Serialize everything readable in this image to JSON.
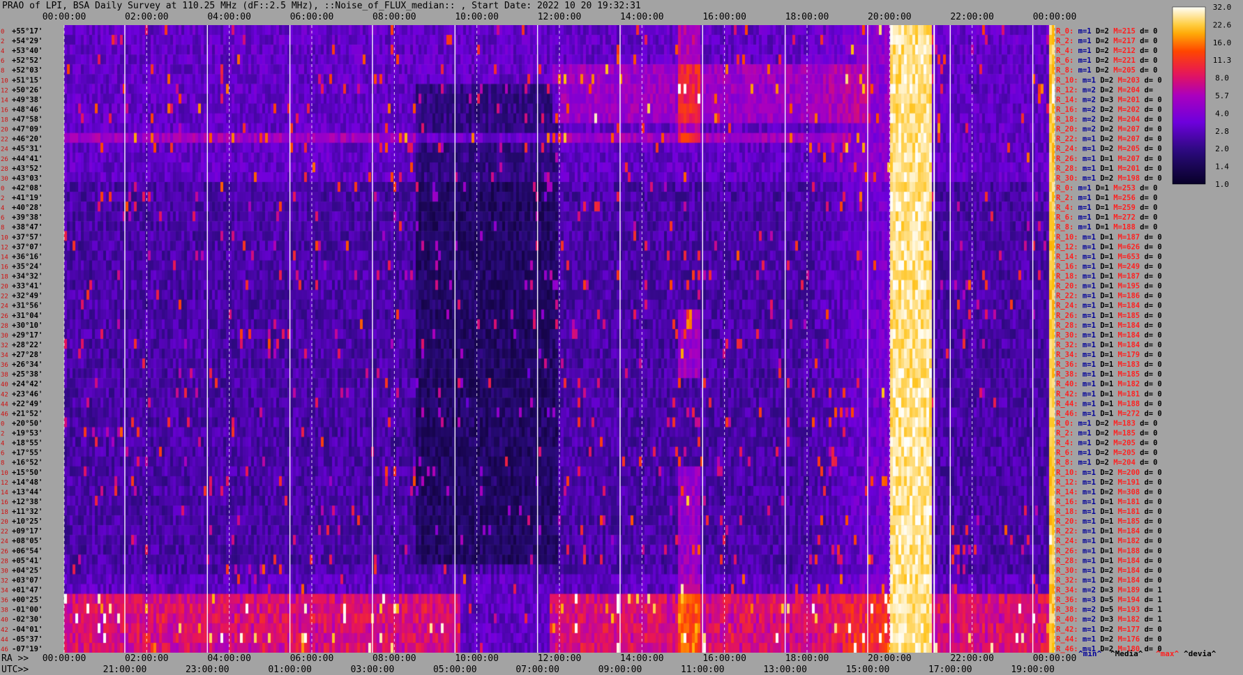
{
  "title": "PRAO of LPI, BSA Daily Survey at 110.25 MHz (dF::2.5 MHz), ::Noise_of_FLUX_median:: , Start Date: 2022 10 20 19:32:31",
  "chart_data": {
    "type": "heatmap",
    "x_top_ticks": [
      "00:00:00",
      "02:00:00",
      "04:00:00",
      "06:00:00",
      "08:00:00",
      "10:00:00",
      "12:00:00",
      "14:00:00",
      "16:00:00",
      "18:00:00",
      "20:00:00",
      "22:00:00",
      "00:00:00"
    ],
    "x_bottom_ra_ticks": [
      "00:00:00",
      "02:00:00",
      "04:00:00",
      "06:00:00",
      "08:00:00",
      "10:00:00",
      "12:00:00",
      "14:00:00",
      "16:00:00",
      "18:00:00",
      "20:00:00",
      "22:00:00",
      "00:00:00"
    ],
    "x_bottom_utc_ticks": [
      "21:00:00",
      "23:00:00",
      "01:00:00",
      "03:00:00",
      "05:00:00",
      "07:00:00",
      "09:00:00",
      "11:00:00",
      "13:00:00",
      "15:00:00",
      "17:00:00",
      "19:00:00"
    ],
    "ra_label": "RA >>",
    "utc_label": "UTC>>",
    "colorbar_ticks": [
      "32.0",
      "22.6",
      "16.0",
      "11.3",
      "8.0",
      "5.7",
      "4.0",
      "2.8",
      "2.0",
      "1.4",
      "1.0"
    ],
    "legend_labels": [
      "^min^",
      "^Media^",
      "^max^",
      "^devia^"
    ],
    "declinations": [
      "+55°17'",
      "+54°29'",
      "+53°40'",
      "+52°52'",
      "+52°03'",
      "+51°15'",
      "+50°26'",
      "+49°38'",
      "+48°46'",
      "+47°58'",
      "+47°09'",
      "+46°20'",
      "+45°31'",
      "+44°41'",
      "+43°52'",
      "+43°03'",
      "+42°08'",
      "+41°19'",
      "+40°28'",
      "+39°38'",
      "+38°47'",
      "+37°57'",
      "+37°07'",
      "+36°16'",
      "+35°24'",
      "+34°32'",
      "+33°41'",
      "+32°49'",
      "+31°56'",
      "+31°04'",
      "+30°10'",
      "+29°17'",
      "+28°22'",
      "+27°28'",
      "+26°34'",
      "+25°38'",
      "+24°42'",
      "+23°46'",
      "+22°49'",
      "+21°52'",
      "+20°50'",
      "+19°53'",
      "+18°55'",
      "+17°55'",
      "+16°52'",
      "+15°50'",
      "+14°48'",
      "+13°44'",
      "+12°38'",
      "+11°32'",
      "+10°25'",
      "+09°17'",
      "+08°05'",
      "+06°54'",
      "+05°41'",
      "+04°25'",
      "+03°07'",
      "+01°47'",
      "+00°25'",
      "-01°00'",
      "-02°30'",
      "-04°01'",
      "-05°37'",
      "-07°19'"
    ],
    "row_indices": [
      "0",
      "2",
      "4",
      "6",
      "8",
      "10",
      "12",
      "14",
      "16",
      "18",
      "20",
      "22",
      "24",
      "26",
      "28",
      "30",
      "0",
      "2",
      "4",
      "6",
      "8",
      "10",
      "12",
      "14",
      "16",
      "18",
      "20",
      "22",
      "24",
      "26",
      "28",
      "30",
      "32",
      "34",
      "36",
      "38",
      "40",
      "42",
      "44",
      "46",
      "0",
      "2",
      "4",
      "6",
      "8",
      "10",
      "12",
      "14",
      "16",
      "18",
      "20",
      "22",
      "24",
      "26",
      "28",
      "30",
      "32",
      "34",
      "36",
      "38",
      "40",
      "42",
      "44",
      "46"
    ],
    "stats": [
      {
        "r": "R_0:",
        "m": "m=1",
        "d": "D=2",
        "M": "M=215",
        "dv": "d= 0"
      },
      {
        "r": "R_2:",
        "m": "m=1",
        "d": "D=2",
        "M": "M=217",
        "dv": "d= 0"
      },
      {
        "r": "R_4:",
        "m": "m=1",
        "d": "D=2",
        "M": "M=212",
        "dv": "d= 0"
      },
      {
        "r": "R_6:",
        "m": "m=1",
        "d": "D=2",
        "M": "M=221",
        "dv": "d= 0"
      },
      {
        "r": "R_8:",
        "m": "m=1",
        "d": "D=2",
        "M": "M=205",
        "dv": "d= 0"
      },
      {
        "r": "R_10:",
        "m": "m=1",
        "d": "D=2",
        "M": "M=203",
        "dv": "d= 0"
      },
      {
        "r": "R_12:",
        "m": "m=2",
        "d": "D=2",
        "M": "M=204",
        "dv": "d= "
      },
      {
        "r": "R_14:",
        "m": "m=2",
        "d": "D=3",
        "M": "M=201",
        "dv": "d= 0"
      },
      {
        "r": "R_16:",
        "m": "m=2",
        "d": "D=2",
        "M": "M=202",
        "dv": "d= 0"
      },
      {
        "r": "R_18:",
        "m": "m=2",
        "d": "D=2",
        "M": "M=204",
        "dv": "d= 0"
      },
      {
        "r": "R_20:",
        "m": "m=2",
        "d": "D=2",
        "M": "M=207",
        "dv": "d= 0"
      },
      {
        "r": "R_22:",
        "m": "m=1",
        "d": "D=2",
        "M": "M=207",
        "dv": "d= 0"
      },
      {
        "r": "R_24:",
        "m": "m=1",
        "d": "D=2",
        "M": "M=205",
        "dv": "d= 0"
      },
      {
        "r": "R_26:",
        "m": "m=1",
        "d": "D=1",
        "M": "M=207",
        "dv": "d= 0"
      },
      {
        "r": "R_28:",
        "m": "m=1",
        "d": "D=1",
        "M": "M=201",
        "dv": "d= 0"
      },
      {
        "r": "R_30:",
        "m": "m=1",
        "d": "D=2",
        "M": "M=198",
        "dv": "d= 0"
      },
      {
        "r": "R_0:",
        "m": "m=1",
        "d": "D=1",
        "M": "M=253",
        "dv": "d= 0"
      },
      {
        "r": "R_2:",
        "m": "m=1",
        "d": "D=1",
        "M": "M=256",
        "dv": "d= 0"
      },
      {
        "r": "R_4:",
        "m": "m=1",
        "d": "D=1",
        "M": "M=259",
        "dv": "d= 0"
      },
      {
        "r": "R_6:",
        "m": "m=1",
        "d": "D=1",
        "M": "M=272",
        "dv": "d= 0"
      },
      {
        "r": "R_8:",
        "m": "m=1",
        "d": "D=1",
        "M": "M=188",
        "dv": "d= 0"
      },
      {
        "r": "R_10:",
        "m": "m=1",
        "d": "D=1",
        "M": "M=187",
        "dv": "d= 0"
      },
      {
        "r": "R_12:",
        "m": "m=1",
        "d": "D=1",
        "M": "M=626",
        "dv": "d= 0"
      },
      {
        "r": "R_14:",
        "m": "m=1",
        "d": "D=1",
        "M": "M=653",
        "dv": "d= 0"
      },
      {
        "r": "R_16:",
        "m": "m=1",
        "d": "D=1",
        "M": "M=249",
        "dv": "d= 0"
      },
      {
        "r": "R_18:",
        "m": "m=1",
        "d": "D=1",
        "M": "M=187",
        "dv": "d= 0"
      },
      {
        "r": "R_20:",
        "m": "m=1",
        "d": "D=1",
        "M": "M=195",
        "dv": "d= 0"
      },
      {
        "r": "R_22:",
        "m": "m=1",
        "d": "D=1",
        "M": "M=186",
        "dv": "d= 0"
      },
      {
        "r": "R_24:",
        "m": "m=1",
        "d": "D=1",
        "M": "M=184",
        "dv": "d= 0"
      },
      {
        "r": "R_26:",
        "m": "m=1",
        "d": "D=1",
        "M": "M=185",
        "dv": "d= 0"
      },
      {
        "r": "R_28:",
        "m": "m=1",
        "d": "D=1",
        "M": "M=184",
        "dv": "d= 0"
      },
      {
        "r": "R_30:",
        "m": "m=1",
        "d": "D=1",
        "M": "M=184",
        "dv": "d= 0"
      },
      {
        "r": "R_32:",
        "m": "m=1",
        "d": "D=1",
        "M": "M=184",
        "dv": "d= 0"
      },
      {
        "r": "R_34:",
        "m": "m=1",
        "d": "D=1",
        "M": "M=179",
        "dv": "d= 0"
      },
      {
        "r": "R_36:",
        "m": "m=1",
        "d": "D=1",
        "M": "M=183",
        "dv": "d= 0"
      },
      {
        "r": "R_38:",
        "m": "m=1",
        "d": "D=1",
        "M": "M=185",
        "dv": "d= 0"
      },
      {
        "r": "R_40:",
        "m": "m=1",
        "d": "D=1",
        "M": "M=182",
        "dv": "d= 0"
      },
      {
        "r": "R_42:",
        "m": "m=1",
        "d": "D=1",
        "M": "M=181",
        "dv": "d= 0"
      },
      {
        "r": "R_44:",
        "m": "m=1",
        "d": "D=1",
        "M": "M=188",
        "dv": "d= 0"
      },
      {
        "r": "R_46:",
        "m": "m=1",
        "d": "D=1",
        "M": "M=272",
        "dv": "d= 0"
      },
      {
        "r": "R_0:",
        "m": "m=1",
        "d": "D=2",
        "M": "M=183",
        "dv": "d= 0"
      },
      {
        "r": "R_2:",
        "m": "m=1",
        "d": "D=2",
        "M": "M=185",
        "dv": "d= 0"
      },
      {
        "r": "R_4:",
        "m": "m=1",
        "d": "D=2",
        "M": "M=205",
        "dv": "d= 0"
      },
      {
        "r": "R_6:",
        "m": "m=1",
        "d": "D=2",
        "M": "M=205",
        "dv": "d= 0"
      },
      {
        "r": "R_8:",
        "m": "m=1",
        "d": "D=2",
        "M": "M=204",
        "dv": "d= 0"
      },
      {
        "r": "R_10:",
        "m": "m=1",
        "d": "D=2",
        "M": "M=200",
        "dv": "d= 0"
      },
      {
        "r": "R_12:",
        "m": "m=1",
        "d": "D=2",
        "M": "M=191",
        "dv": "d= 0"
      },
      {
        "r": "R_14:",
        "m": "m=1",
        "d": "D=2",
        "M": "M=308",
        "dv": "d= 0"
      },
      {
        "r": "R_16:",
        "m": "m=1",
        "d": "D=1",
        "M": "M=181",
        "dv": "d= 0"
      },
      {
        "r": "R_18:",
        "m": "m=1",
        "d": "D=1",
        "M": "M=181",
        "dv": "d= 0"
      },
      {
        "r": "R_20:",
        "m": "m=1",
        "d": "D=1",
        "M": "M=185",
        "dv": "d= 0"
      },
      {
        "r": "R_22:",
        "m": "m=1",
        "d": "D=1",
        "M": "M=184",
        "dv": "d= 0"
      },
      {
        "r": "R_24:",
        "m": "m=1",
        "d": "D=1",
        "M": "M=182",
        "dv": "d= 0"
      },
      {
        "r": "R_26:",
        "m": "m=1",
        "d": "D=1",
        "M": "M=188",
        "dv": "d= 0"
      },
      {
        "r": "R_28:",
        "m": "m=1",
        "d": "D=1",
        "M": "M=184",
        "dv": "d= 0"
      },
      {
        "r": "R_30:",
        "m": "m=1",
        "d": "D=2",
        "M": "M=184",
        "dv": "d= 0"
      },
      {
        "r": "R_32:",
        "m": "m=1",
        "d": "D=2",
        "M": "M=184",
        "dv": "d= 0"
      },
      {
        "r": "R_34:",
        "m": "m=2",
        "d": "D=3",
        "M": "M=189",
        "dv": "d= 1"
      },
      {
        "r": "R_36:",
        "m": "m=3",
        "d": "D=5",
        "M": "M=194",
        "dv": "d= 1"
      },
      {
        "r": "R_38:",
        "m": "m=2",
        "d": "D=5",
        "M": "M=193",
        "dv": "d= 1"
      },
      {
        "r": "R_40:",
        "m": "m=2",
        "d": "D=3",
        "M": "M=182",
        "dv": "d= 1"
      },
      {
        "r": "R_42:",
        "m": "m=1",
        "d": "D=2",
        "M": "M=177",
        "dv": "d= 0"
      },
      {
        "r": "R_44:",
        "m": "m=1",
        "d": "D=2",
        "M": "M=176",
        "dv": "d= 0"
      },
      {
        "r": "R_46:",
        "m": "m=1",
        "d": "D=2",
        "M": "M=180",
        "dv": "d= 0"
      }
    ],
    "features": {
      "bright_columns_hours": [
        [
          20.0,
          20.97
        ],
        [
          23.85,
          24.0
        ]
      ],
      "bright_column_cyan_line_hour": 21.08,
      "low_dec_band_rows": [
        58,
        63
      ],
      "dark_block_hours": [
        8.5,
        11.9
      ],
      "source_hours": [
        14.85,
        15.4
      ]
    },
    "colors": {
      "accent_red": "#ff2020",
      "accent_blue": "#000099"
    }
  }
}
